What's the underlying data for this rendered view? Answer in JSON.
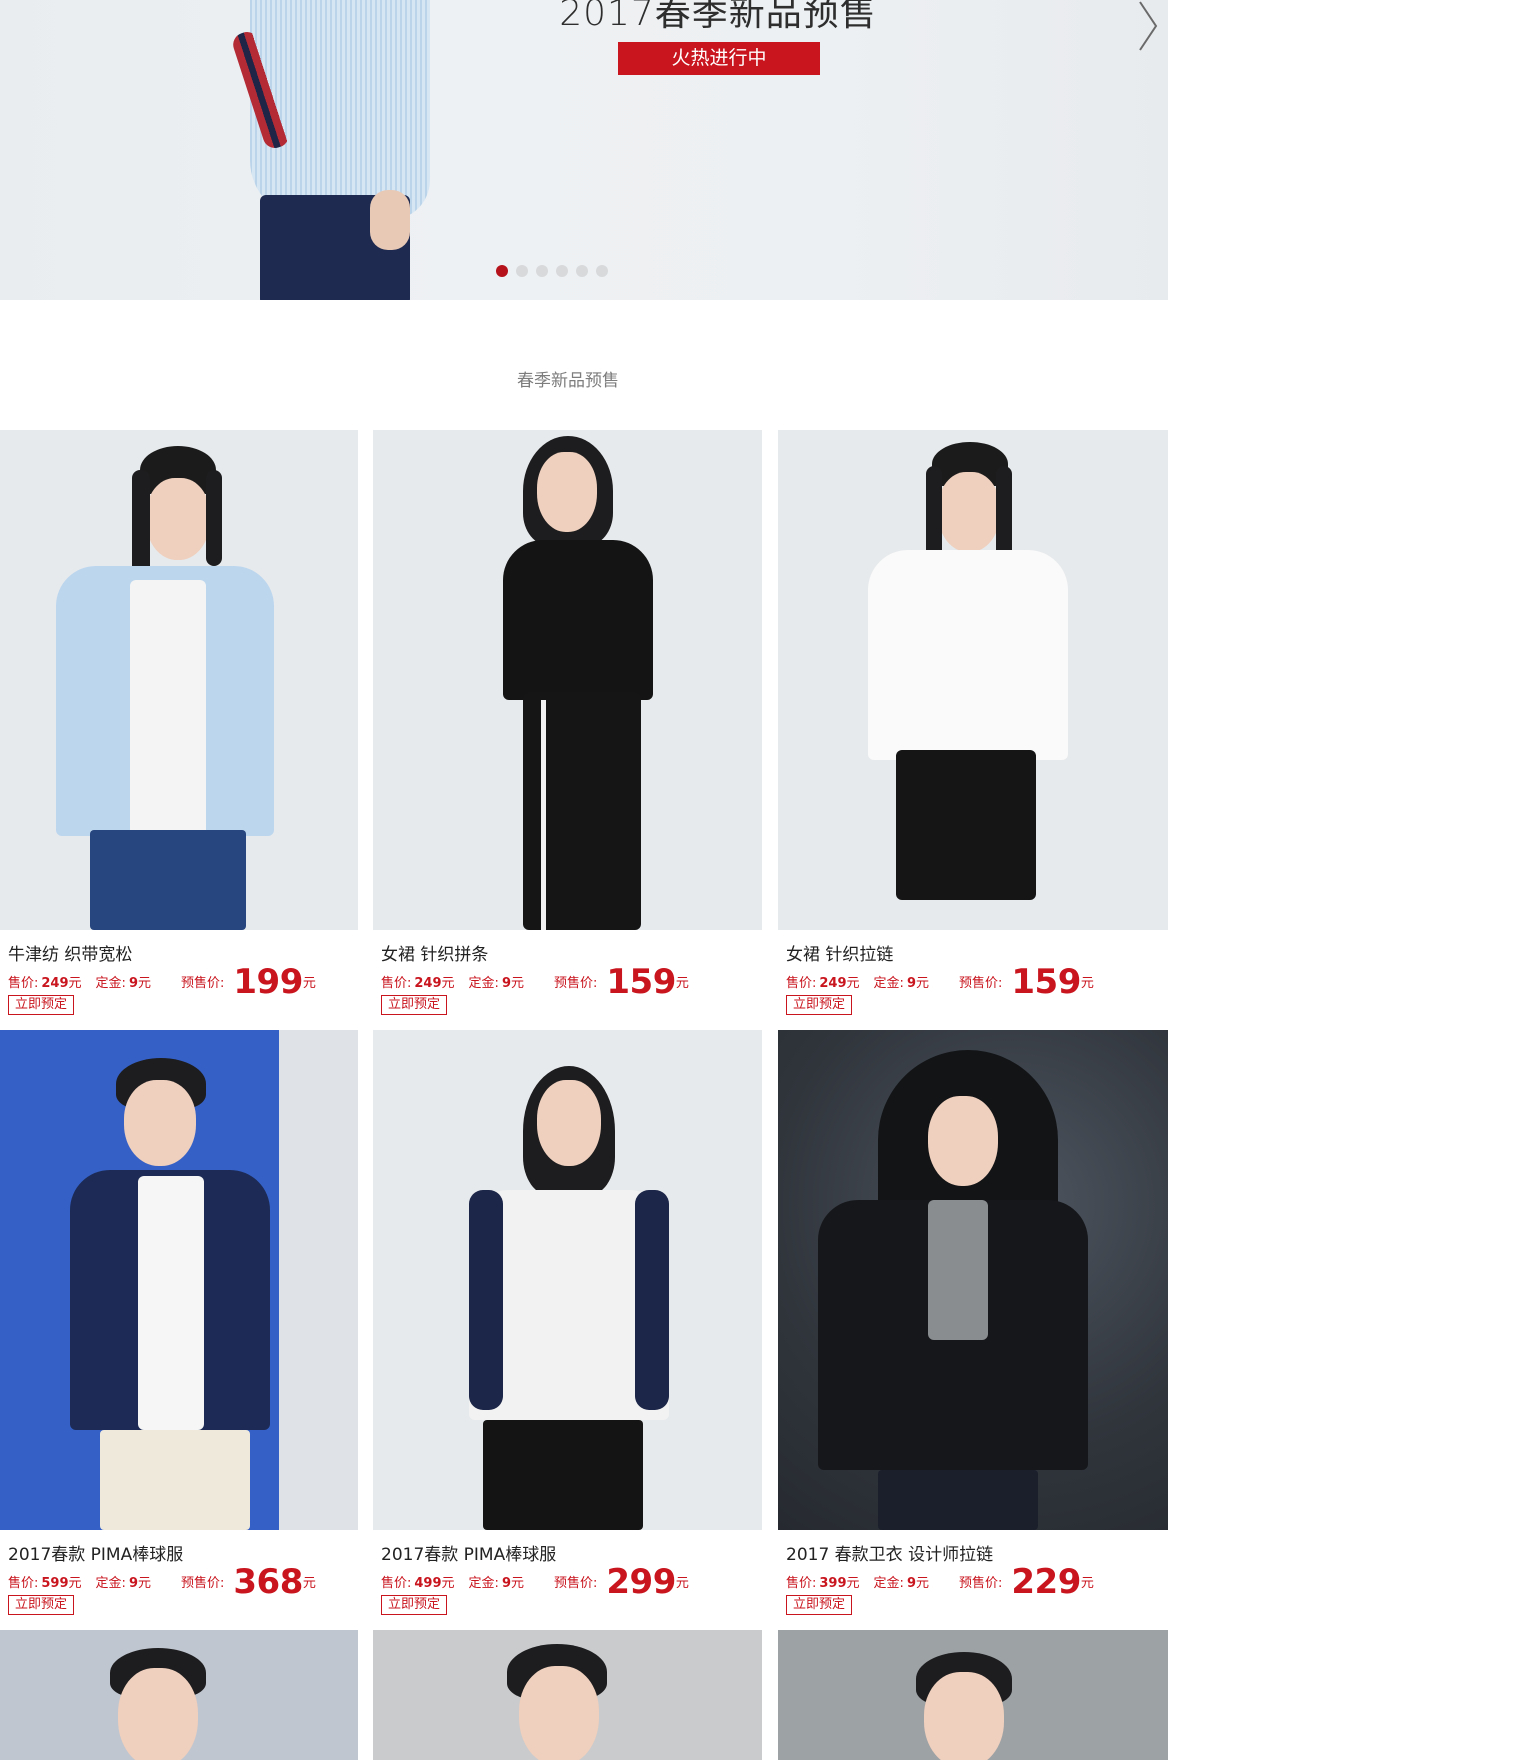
{
  "banner": {
    "title": "2017春季新品预售",
    "button_label": "火热进行中",
    "next_icon": "chevron-right-icon",
    "dots": 6,
    "active_dot": 1
  },
  "section": {
    "title": "春季新品预售"
  },
  "labels": {
    "sale_price": "售价:",
    "deposit": "定金:",
    "presale_price": "预售价:",
    "currency": "元",
    "reserve_button": "立即预定"
  },
  "products": [
    {
      "name": "牛津纺 织带宽松",
      "sale_price": "249",
      "deposit": "9",
      "presale_price": "199"
    },
    {
      "name": "女裙 针织拼条",
      "sale_price": "249",
      "deposit": "9",
      "presale_price": "159"
    },
    {
      "name": "女裙 针织拉链",
      "sale_price": "249",
      "deposit": "9",
      "presale_price": "159"
    },
    {
      "name": "2017春款 PIMA棒球服",
      "sale_price": "599",
      "deposit": "9",
      "presale_price": "368"
    },
    {
      "name": "2017春款 PIMA棒球服",
      "sale_price": "499",
      "deposit": "9",
      "presale_price": "299"
    },
    {
      "name": "2017 春款卫衣 设计师拉链",
      "sale_price": "399",
      "deposit": "9",
      "presale_price": "229"
    }
  ],
  "colors": {
    "accent": "#c9151e",
    "dot_inactive": "#d7d9db",
    "dot_active": "#b5121b"
  }
}
